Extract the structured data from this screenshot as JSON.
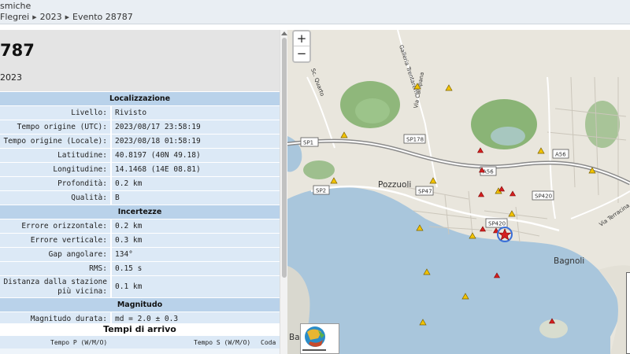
{
  "header": {
    "title_fragment": "smiche",
    "breadcrumb": [
      "Flegrei",
      "2023",
      "Evento 28787"
    ]
  },
  "event": {
    "number_fragment": "787",
    "year_fragment": "2023"
  },
  "sections": {
    "localizzazione": "Localizzazione",
    "incertezze": "Incertezze",
    "magnitudo": "Magnitudo"
  },
  "fields": {
    "livello": {
      "label": "Livello:",
      "value": "Rivisto"
    },
    "tempo_utc": {
      "label": "Tempo origine (UTC):",
      "value": "2023/08/17 23:58:19"
    },
    "tempo_locale": {
      "label": "Tempo origine (Locale):",
      "value": "2023/08/18 01:58:19"
    },
    "latitudine": {
      "label": "Latitudine:",
      "value": "40.8197 (40N 49.18)"
    },
    "longitudine": {
      "label": "Longitudine:",
      "value": "14.1468 (14E 08.81)"
    },
    "profondita": {
      "label": "Profondità:",
      "value": "0.2 km"
    },
    "qualita": {
      "label": "Qualità:",
      "value": "B"
    },
    "errore_orizzontale": {
      "label": "Errore orizzontale:",
      "value": "0.2 km"
    },
    "errore_verticale": {
      "label": "Errore verticale:",
      "value": "0.3 km"
    },
    "gap_angolare": {
      "label": "Gap angolare:",
      "value": "134°"
    },
    "rms": {
      "label": "RMS:",
      "value": "0.15 s"
    },
    "distanza_stazione": {
      "label_line1": "Distanza dalla stazione",
      "label_line2": "più vicina:",
      "value": "0.1 km"
    },
    "magnitudo_durata": {
      "label": "Magnitudo durata:",
      "value": "md = 2.0 ± 0.3"
    }
  },
  "arrivi": {
    "title": "Tempi di arrivo",
    "columns": [
      "Tempo P (W/M/O)",
      "Tempo S (W/M/O)",
      "Coda"
    ]
  },
  "map": {
    "zoom_in": "+",
    "zoom_out": "−",
    "places": [
      "Pozzuoli",
      "Bagnoli",
      "Bacoli"
    ],
    "roads": [
      "SP1",
      "SP178",
      "A56",
      "A56",
      "SP2",
      "SP47",
      "SP420",
      "SP420"
    ],
    "street_labels": [
      "Galleria Trentaremi",
      "Via Campana",
      "Via Terracina",
      "Sc. Quarto"
    ],
    "colors": {
      "sea": "#a9c6dc",
      "land": "#e9e6dd",
      "crater": "#7fae6a",
      "station": "#f2c200",
      "quake": "#d42020",
      "epicenter_ring": "#3a6fd8"
    }
  }
}
